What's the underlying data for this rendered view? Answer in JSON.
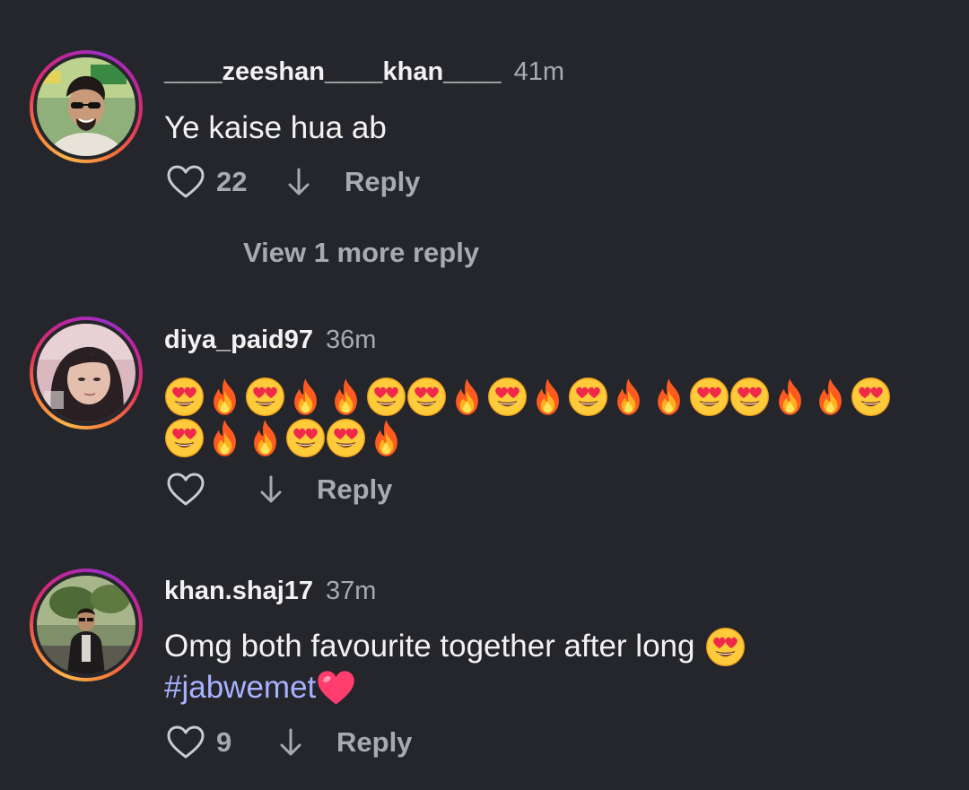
{
  "comments": [
    {
      "username": "____zeeshan____khan____",
      "time": "41m",
      "text": "Ye kaise hua ab",
      "likes": "22",
      "reply_label": "Reply",
      "view_more": "View 1 more reply"
    },
    {
      "username": "diya_paid97",
      "time": "36m",
      "emoji_line_1": [
        "heart-eyes",
        "fire",
        "heart-eyes",
        "fire",
        "fire",
        "heart-eyes",
        "heart-eyes",
        "fire",
        "heart-eyes",
        "fire",
        "heart-eyes",
        "fire",
        "fire",
        "heart-eyes",
        "heart-eyes",
        "fire",
        "fire",
        "heart-eyes"
      ],
      "emoji_line_2": [
        "heart-eyes",
        "fire",
        "fire",
        "heart-eyes",
        "heart-eyes",
        "fire"
      ],
      "likes": "",
      "reply_label": "Reply"
    },
    {
      "username": "khan.shaj17",
      "time": "37m",
      "text": "Omg both favourite together after long",
      "hashtag": "#jabwemet",
      "likes": "9",
      "reply_label": "Reply"
    }
  ],
  "colors": {
    "background": "#25262b",
    "text": "#f2f2f2",
    "muted": "#a8aab0",
    "hashtag": "#a7b1ff"
  }
}
